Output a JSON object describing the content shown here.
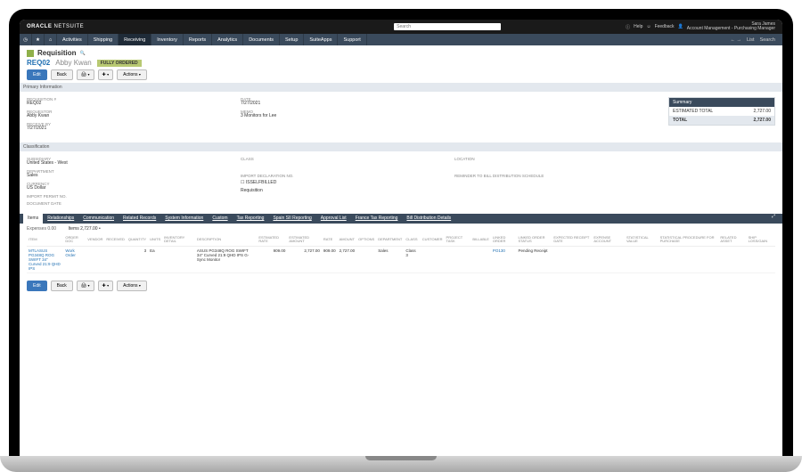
{
  "brand": {
    "oracle": "ORACLE",
    "netsuite": "NETSUITE"
  },
  "user": {
    "name": "Sara James",
    "role": "Account Management - Purchasing Manager",
    "help": "Help",
    "feedback": "Feedback"
  },
  "nav": [
    "Activities",
    "Shipping",
    "Receiving",
    "Inventory",
    "Reports",
    "Analytics",
    "Documents",
    "Setup",
    "SuiteApps",
    "Support"
  ],
  "nav_active_index": 2,
  "right_nav": {
    "arrows": "← →",
    "list": "List",
    "search": "Search"
  },
  "page": {
    "title": "Requisition",
    "record_id": "REQ02",
    "record_name": "Abby Kwan",
    "status_badge": "FULLY ORDERED"
  },
  "buttons": {
    "edit": "Edit",
    "back": "Back",
    "actions": "Actions"
  },
  "sections": {
    "primary": "Primary Information",
    "classification": "Classification"
  },
  "primary": {
    "requisition_no": {
      "label": "REQUISITION #",
      "value": "REQ02"
    },
    "requestor": {
      "label": "REQUESTOR",
      "value": "Abby Kwan"
    },
    "receive_by": {
      "label": "RECEIVE BY",
      "value": "7/27/2021"
    },
    "date": {
      "label": "DATE",
      "value": "7/27/2021"
    },
    "memo": {
      "label": "MEMO",
      "value": "3 Monitors for Lee"
    }
  },
  "summary": {
    "title": "Summary",
    "est_total_label": "ESTIMATED TOTAL",
    "est_total": "2,727.00",
    "total_label": "TOTAL",
    "total": "2,727.00"
  },
  "classification": {
    "subsidiary": {
      "label": "SUBSIDIARY",
      "value": "United States - West"
    },
    "department": {
      "label": "DEPARTMENT",
      "value": "Sales"
    },
    "currency": {
      "label": "CURRENCY",
      "value": "US Dollar"
    },
    "import_permit": {
      "label": "IMPORT PERMIT NO.",
      "value": ""
    },
    "document_date": {
      "label": "DOCUMENT DATE",
      "value": ""
    },
    "class": {
      "label": "CLASS",
      "value": ""
    },
    "import_decl": {
      "label": "IMPORT DECLARATION NO.",
      "value": ""
    },
    "isselfbilled": {
      "label": "ISSELFBILLED",
      "value": ""
    },
    "createdfrom": {
      "label": "",
      "value": "Requisition"
    },
    "location": {
      "label": "LOCATION",
      "value": ""
    },
    "reminder": {
      "label": "REMINDER TO BILL DISTRIBUTION SCHEDULE",
      "value": ""
    }
  },
  "tabs": [
    "Items",
    "Relationships",
    "Communication",
    "Related Records",
    "System Information",
    "Custom",
    "Tax Reporting",
    "Spain SII Reporting",
    "Approval List",
    "France Tax Reporting",
    "Bill Distribution Details"
  ],
  "tabs_active_index": 0,
  "subline": {
    "expenses": "Expenses 0.00",
    "items_total": "Items 2,727.00 •"
  },
  "table_headers": [
    "ITEM",
    "ORDER DOC",
    "VENDOR",
    "RECEIVED",
    "QUANTITY",
    "UNITS",
    "INVENTORY DETAIL",
    "DESCRIPTION",
    "ESTIMATED RATE",
    "ESTIMATED AMOUNT",
    "RATE",
    "AMOUNT",
    "OPTIONS",
    "DEPARTMENT",
    "CLASS",
    "CUSTOMER",
    "PROJECT TASK",
    "BILLABLE",
    "LINKED ORDER",
    "LINKED ORDER STATUS",
    "EXPECTED RECEIPT DATE",
    "EXPENSE ACCOUNT",
    "STATISTICAL VALUE",
    "STATISTICAL PROCEDURE FOR PURCHASE",
    "RELATED ASSET",
    "SHIP LOSS/GAIN"
  ],
  "table_row": {
    "item": "MTLASUS PG348Q ROG SWIFT 34\" Curved 21:9 QHD IPS",
    "order_doc": "Work Order",
    "vendor": "",
    "received": "",
    "quantity": "3",
    "units": "Ea",
    "inventory_detail": "",
    "description": "ASUS PG348Q ROG SWIFT 34\" Curved 21:9 QHD IPS G-Sync Monitor",
    "est_rate": "909.00",
    "est_amount": "2,727.00",
    "rate": "909.00",
    "amount": "2,727.00",
    "options": "",
    "department": "Sales",
    "cls": "Class 3",
    "customer": "",
    "project_task": "",
    "billable": "",
    "linked_order": "PO130",
    "linked_status": "Pending Receipt",
    "receipt_date": "",
    "expense_acct": "",
    "stat_val": "",
    "stat_proc": "",
    "related_asset": "",
    "ship_loss": ""
  },
  "search_placeholder": "Search"
}
